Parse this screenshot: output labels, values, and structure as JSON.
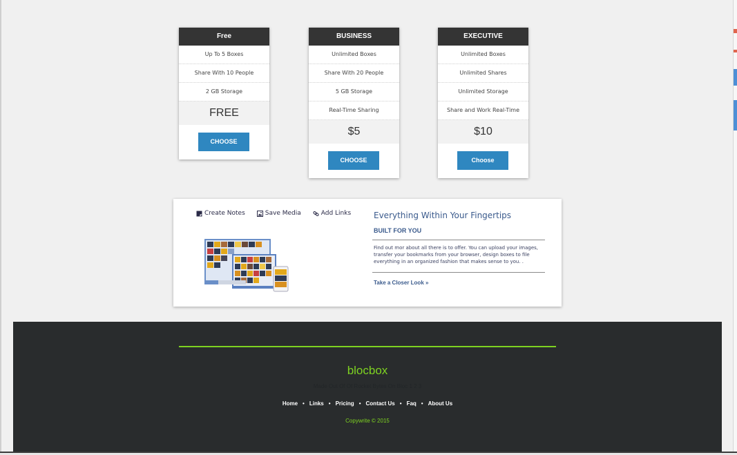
{
  "pricing": {
    "plans": [
      {
        "name": "Free",
        "features": [
          "Up To 5 Boxes",
          "Share With 10 People",
          "2 GB Storage"
        ],
        "price": "FREE",
        "button": "CHOOSE"
      },
      {
        "name": "BUSINESS",
        "features": [
          "Unlimited Boxes",
          "Share With 20 People",
          "5 GB Storage",
          "Real-Time Sharing"
        ],
        "price": "$5",
        "button": "CHOOSE"
      },
      {
        "name": "EXECUTIVE",
        "features": [
          "Unlimited Boxes",
          "Unlimited Shares",
          "Unlimited Storage",
          "Share and Work Real-Time"
        ],
        "price": "$10",
        "button": "Choose"
      }
    ]
  },
  "feature": {
    "tabs": [
      {
        "label": "Create Notes",
        "icon": "note-icon"
      },
      {
        "label": "Save Media",
        "icon": "image-icon"
      },
      {
        "label": "Add Links",
        "icon": "link-icon"
      }
    ],
    "title": "Everything Within Your Fingertips",
    "subtitle": "BUILT FOR YOU",
    "body": "Find out mor about all there is to offer. You can upload your images, transfer your bookmarks from your browser, design boxes to file everything in an organized fashion that makes sense to you. .",
    "link": "Take a Closer Look »"
  },
  "footer": {
    "logo": "blocbox",
    "tagline": "Made Out Of Of Rocket Bytes On Bloc 1 2 3",
    "nav": [
      "Home",
      "Links",
      "Pricing",
      "Contact Us",
      "Faq",
      "About Us"
    ],
    "copyright": "Copywrite © 2015",
    "accent_color": "#7ed321"
  },
  "colors": {
    "button": "#2f87c0",
    "header": "#343434",
    "footer_bg": "#292c2d"
  }
}
